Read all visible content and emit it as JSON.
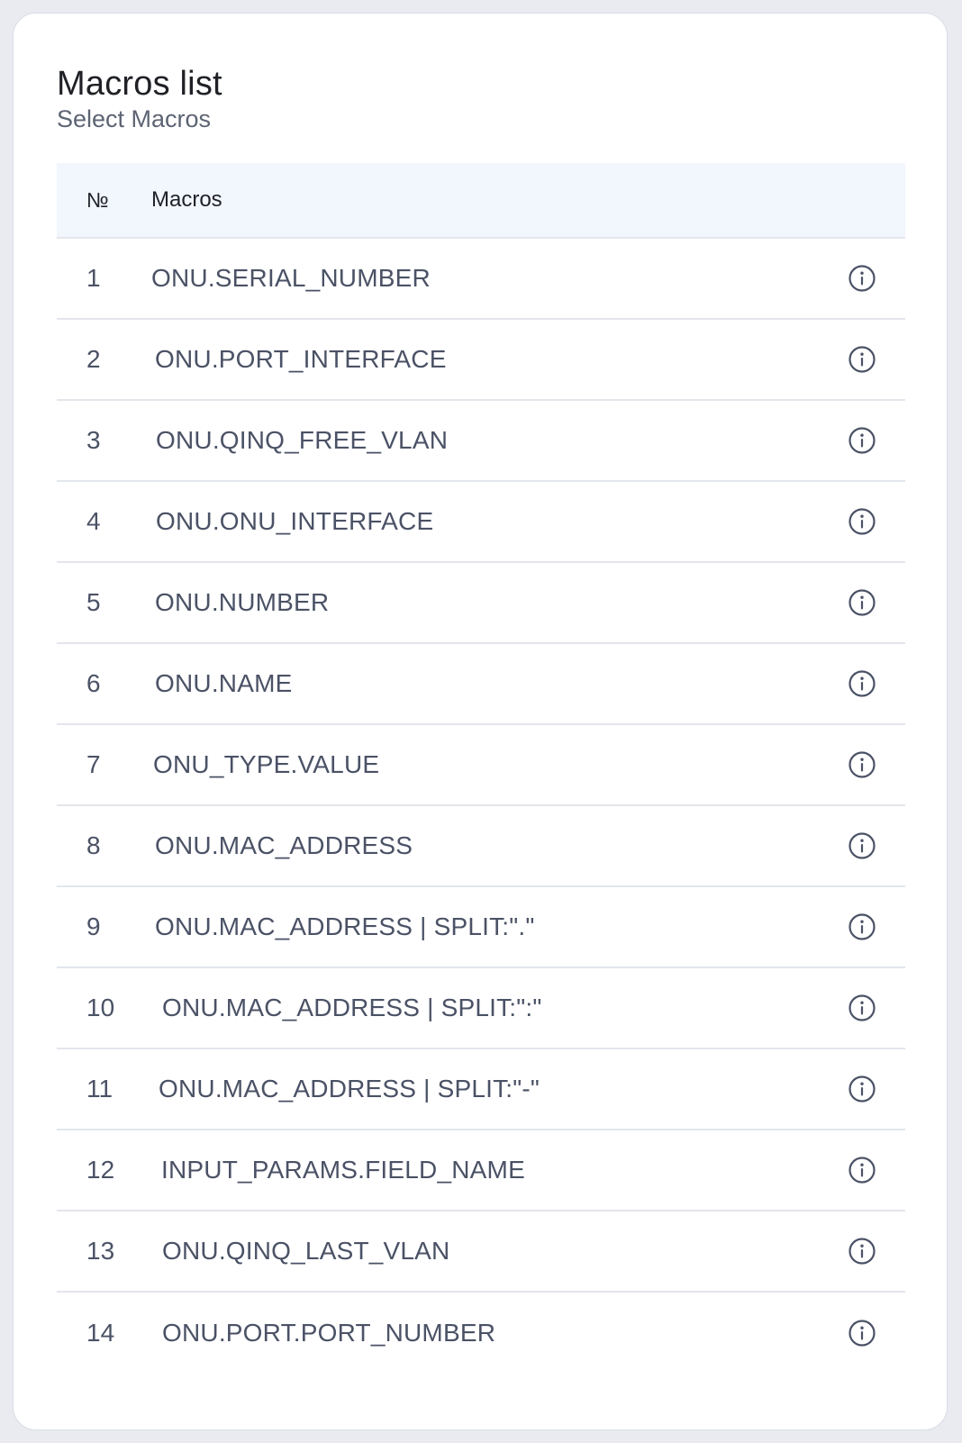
{
  "panel": {
    "title": "Macros list",
    "subtitle": "Select Macros"
  },
  "table": {
    "headers": {
      "number": "№",
      "macros": "Macros"
    },
    "rows": [
      {
        "number": "1",
        "macro": "ONU.SERIAL_NUMBER"
      },
      {
        "number": "2",
        "macro": "ONU.PORT_INTERFACE"
      },
      {
        "number": "3",
        "macro": "ONU.QINQ_FREE_VLAN"
      },
      {
        "number": "4",
        "macro": "ONU.ONU_INTERFACE"
      },
      {
        "number": "5",
        "macro": "ONU.NUMBER"
      },
      {
        "number": "6",
        "macro": "ONU.NAME"
      },
      {
        "number": "7",
        "macro": "ONU_TYPE.VALUE"
      },
      {
        "number": "8",
        "macro": "ONU.MAC_ADDRESS"
      },
      {
        "number": "9",
        "macro": "ONU.MAC_ADDRESS | SPLIT:\".\""
      },
      {
        "number": "10",
        "macro": "ONU.MAC_ADDRESS | SPLIT:\":\""
      },
      {
        "number": "11",
        "macro": "ONU.MAC_ADDRESS | SPLIT:\"-\""
      },
      {
        "number": "12",
        "macro": "INPUT_PARAMS.FIELD_NAME"
      },
      {
        "number": "13",
        "macro": "ONU.QINQ_LAST_VLAN"
      },
      {
        "number": "14",
        "macro": "ONU.PORT.PORT_NUMBER"
      }
    ],
    "row_icon": "info-icon"
  },
  "colors": {
    "page_background": "#e9ebf0",
    "card_background": "#ffffff",
    "header_background": "#f2f6fd",
    "text_primary": "#1f2126",
    "text_secondary": "#4b5266",
    "divider": "#e3e6ec"
  }
}
